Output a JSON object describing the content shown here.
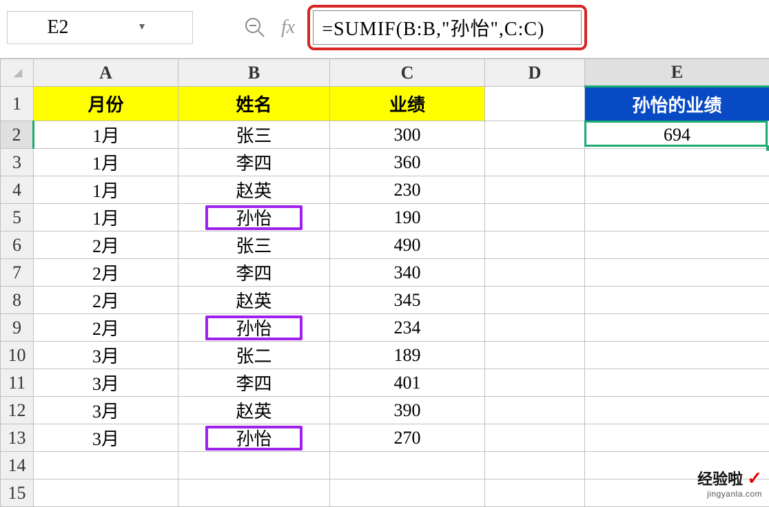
{
  "formulaBar": {
    "cellRef": "E2",
    "fxLabel": "fx",
    "formula": "=SUMIF(B:B,\"孙怡\",C:C)"
  },
  "columns": [
    "A",
    "B",
    "C",
    "D",
    "E"
  ],
  "headers": {
    "A": "月份",
    "B": "姓名",
    "C": "业绩",
    "E": "孙怡的业绩"
  },
  "rows": [
    {
      "n": 2,
      "A": "1月",
      "B": "张三",
      "C": "300",
      "E": "694"
    },
    {
      "n": 3,
      "A": "1月",
      "B": "李四",
      "C": "360"
    },
    {
      "n": 4,
      "A": "1月",
      "B": "赵英",
      "C": "230"
    },
    {
      "n": 5,
      "A": "1月",
      "B": "孙怡",
      "C": "190"
    },
    {
      "n": 6,
      "A": "2月",
      "B": "张三",
      "C": "490"
    },
    {
      "n": 7,
      "A": "2月",
      "B": "李四",
      "C": "340"
    },
    {
      "n": 8,
      "A": "2月",
      "B": "赵英",
      "C": "345"
    },
    {
      "n": 9,
      "A": "2月",
      "B": "孙怡",
      "C": "234"
    },
    {
      "n": 10,
      "A": "3月",
      "B": "张二",
      "C": "189"
    },
    {
      "n": 11,
      "A": "3月",
      "B": "李四",
      "C": "401"
    },
    {
      "n": 12,
      "A": "3月",
      "B": "赵英",
      "C": "390"
    },
    {
      "n": 13,
      "A": "3月",
      "B": "孙怡",
      "C": "270"
    },
    {
      "n": 14
    },
    {
      "n": 15
    }
  ],
  "selectedCell": "E2",
  "highlightedNameRows": [
    5,
    9,
    13
  ],
  "watermark": {
    "line1": "经验啦",
    "check": "✓",
    "line2": "jingyanla.com"
  }
}
